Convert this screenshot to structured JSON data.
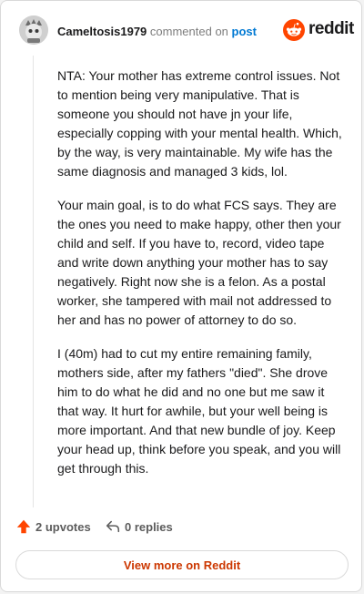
{
  "comment": {
    "username": "Cameltosis1979",
    "action_text": "commented on",
    "post_link": "post",
    "paragraphs": [
      "NTA: Your mother has extreme control issues. Not to mention being very manipulative. That is someone you should not have jn your life, especially copping with your mental health. Which, by the way, is very maintainable. My wife has the same diagnosis and managed 3 kids, lol.",
      "Your main goal, is to do what FCS says. They are the ones you need to make happy, other then your child and self. If you have to, record, video tape and write down anything your mother has to say negatively. Right now she is a felon. As a postal worker, she tampered with mail not addressed to her and has no power of attorney to do so.",
      "I (40m) had to cut my entire remaining family, mothers side, after my fathers \"died\". She drove him to do what he did and no one but me saw it that way. It hurt for awhile, but your well being is more important. And that new bundle of joy. Keep your head up, think before you speak, and you will get through this."
    ],
    "upvotes": "2 upvotes",
    "replies": "0 replies"
  },
  "brand": {
    "name": "reddit",
    "icon": "reddit-logo-icon",
    "color": "#ff4500"
  },
  "footer": {
    "view_more_label": "View more on Reddit"
  },
  "colors": {
    "upvote": "#ff4500",
    "link": "#0079d3",
    "cta": "#cc3700"
  }
}
